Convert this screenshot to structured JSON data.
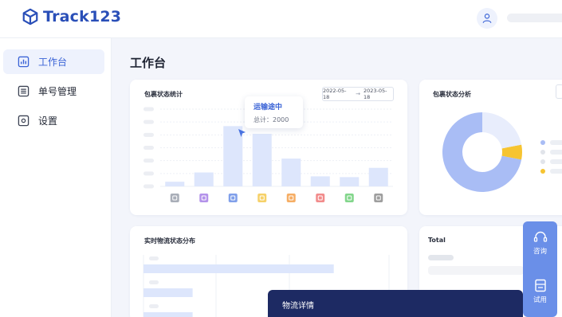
{
  "app": {
    "logo_text": "Track123"
  },
  "sidebar": {
    "items": [
      {
        "label": "工作台",
        "icon": "dashboard-icon",
        "active": true
      },
      {
        "label": "单号管理",
        "icon": "list-icon",
        "active": false
      },
      {
        "label": "设置",
        "icon": "gear-icon",
        "active": false
      }
    ]
  },
  "page": {
    "title": "工作台"
  },
  "status_card": {
    "title": "包裹状态统计",
    "date_from": "2022-05-18",
    "date_to": "2023-05-18",
    "tooltip": {
      "title": "运输途中",
      "value_text": "总计：2000"
    }
  },
  "analysis_card": {
    "title": "包裹状态分析"
  },
  "realtime_card": {
    "title": "实时物流状态分布"
  },
  "total_card": {
    "title": "Total"
  },
  "float_actions": {
    "consult_label": "咨询",
    "trial_label": "试用"
  },
  "detail_panel": {
    "title": "物流详情"
  },
  "colors": {
    "accent": "#3a63d6",
    "bar": "#dde6fc",
    "pie_main": "#a9bdf5",
    "pie_light": "#e8edfc",
    "pie_yellow": "#f6c431",
    "bottom_bar": "#1d2a63",
    "float_panel": "#6a8fe8"
  },
  "chart_data": [
    {
      "type": "bar",
      "title": "包裹状态统计",
      "categories": [
        "status-1",
        "status-2",
        "status-3",
        "status-4",
        "status-5",
        "status-6",
        "status-7",
        "status-8"
      ],
      "category_icon_colors": [
        "#9aa0ac",
        "#a780e6",
        "#6b8fe6",
        "#f5c94f",
        "#f5a04a",
        "#f07878",
        "#6dcf78",
        "#8d8d8d"
      ],
      "values": [
        0.6,
        1.8,
        7.8,
        6.8,
        3.6,
        1.3,
        1.2,
        2.4
      ],
      "ylim": [
        0,
        10
      ],
      "grid": true
    },
    {
      "type": "pie",
      "title": "包裹状态分析",
      "slices": [
        {
          "value": 72,
          "color": "#a9bdf5"
        },
        {
          "value": 6,
          "color": "#f6c431"
        },
        {
          "value": 22,
          "color": "#e8edfc"
        }
      ],
      "legend_dot_colors": [
        "#a9bdf5",
        "#e1e4ea",
        "#e1e4ea",
        "#f6c431"
      ],
      "legend_position": "right"
    },
    {
      "type": "bar",
      "title": "实时物流状态分布",
      "orientation": "horizontal",
      "values": [
        62,
        16,
        16
      ],
      "xlim": [
        0,
        80
      ],
      "grid": true
    }
  ]
}
